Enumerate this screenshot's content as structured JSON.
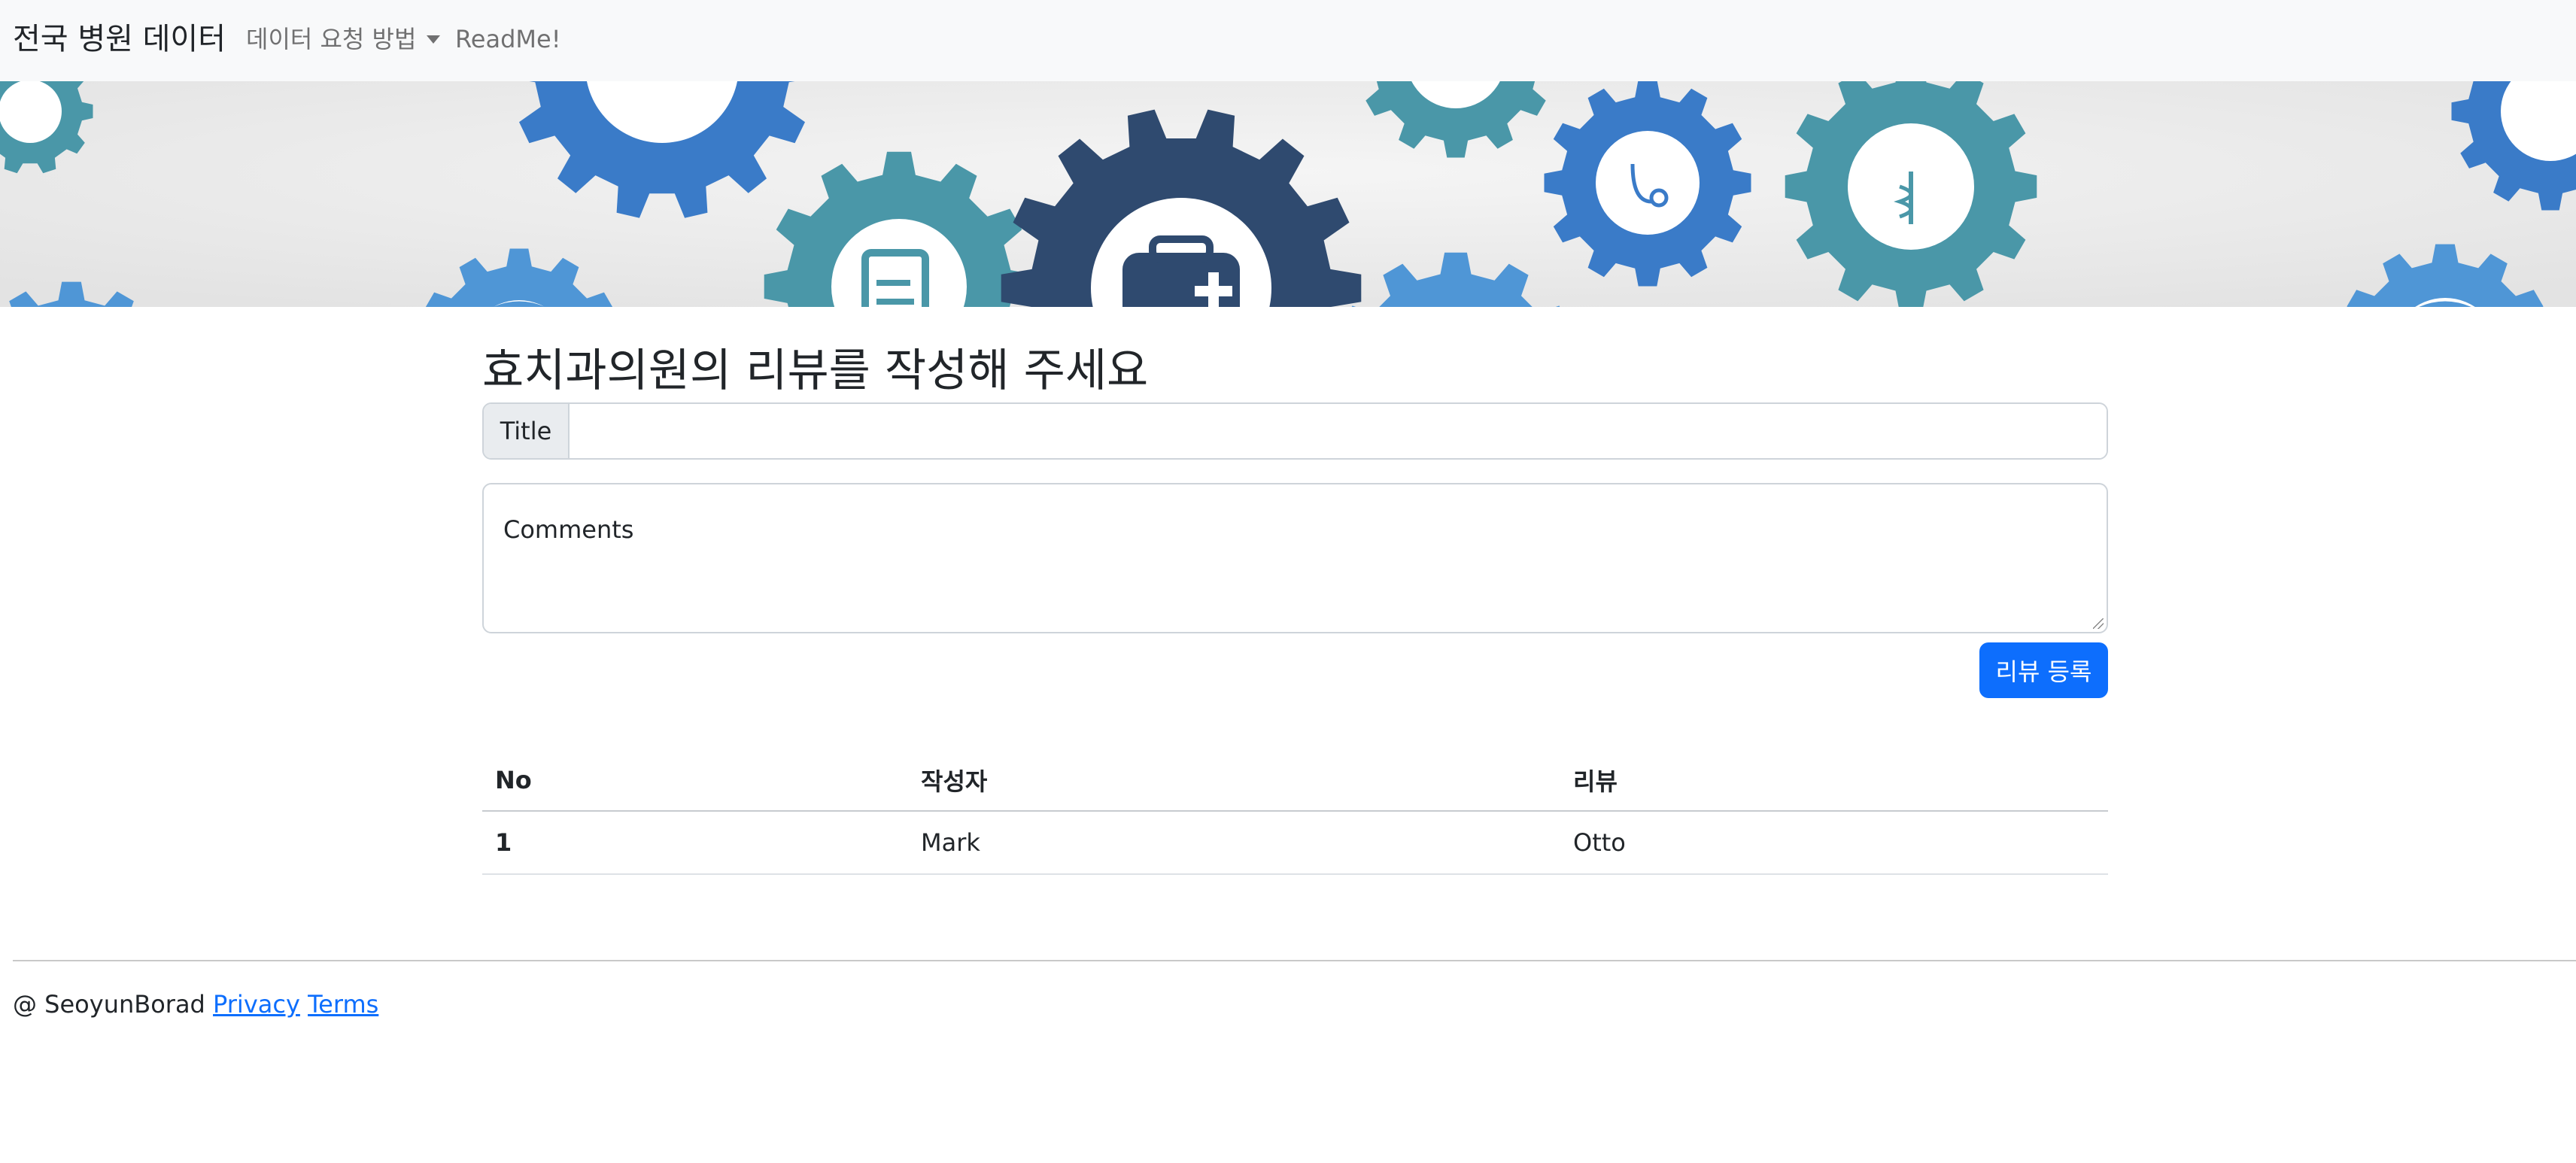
{
  "navbar": {
    "brand": "전국 병원 데이터",
    "dropdown_label": "데이터 요청 방법",
    "readme_label": "ReadMe!"
  },
  "banner": {
    "icons": [
      "car-icon",
      "document-pencil-icon",
      "medical-kit-icon",
      "stethoscope-icon",
      "caduceus-icon",
      "tooth-icon",
      "flask-icon",
      "syringe-icon",
      "medical-bag-icon"
    ]
  },
  "form": {
    "heading": "효치과의원의 리뷰를 작성해 주세요",
    "title_label": "Title",
    "title_value": "",
    "comments_label": "Comments",
    "submit_label": "리뷰 등록"
  },
  "table": {
    "headers": [
      "No",
      "작성자",
      "리뷰"
    ],
    "rows": [
      [
        "1",
        "Mark",
        "Otto"
      ]
    ]
  },
  "footer": {
    "text": "@ SeoyunBorad",
    "privacy": "Privacy",
    "terms": "Terms"
  },
  "colors": {
    "primary": "#0d6efd",
    "navbar_bg": "#f8f9fa",
    "gear_teal": "#4a97a8",
    "gear_blue": "#3a7bc8",
    "gear_navy": "#2f4a6f",
    "gear_light_blue": "#4f96d6"
  }
}
